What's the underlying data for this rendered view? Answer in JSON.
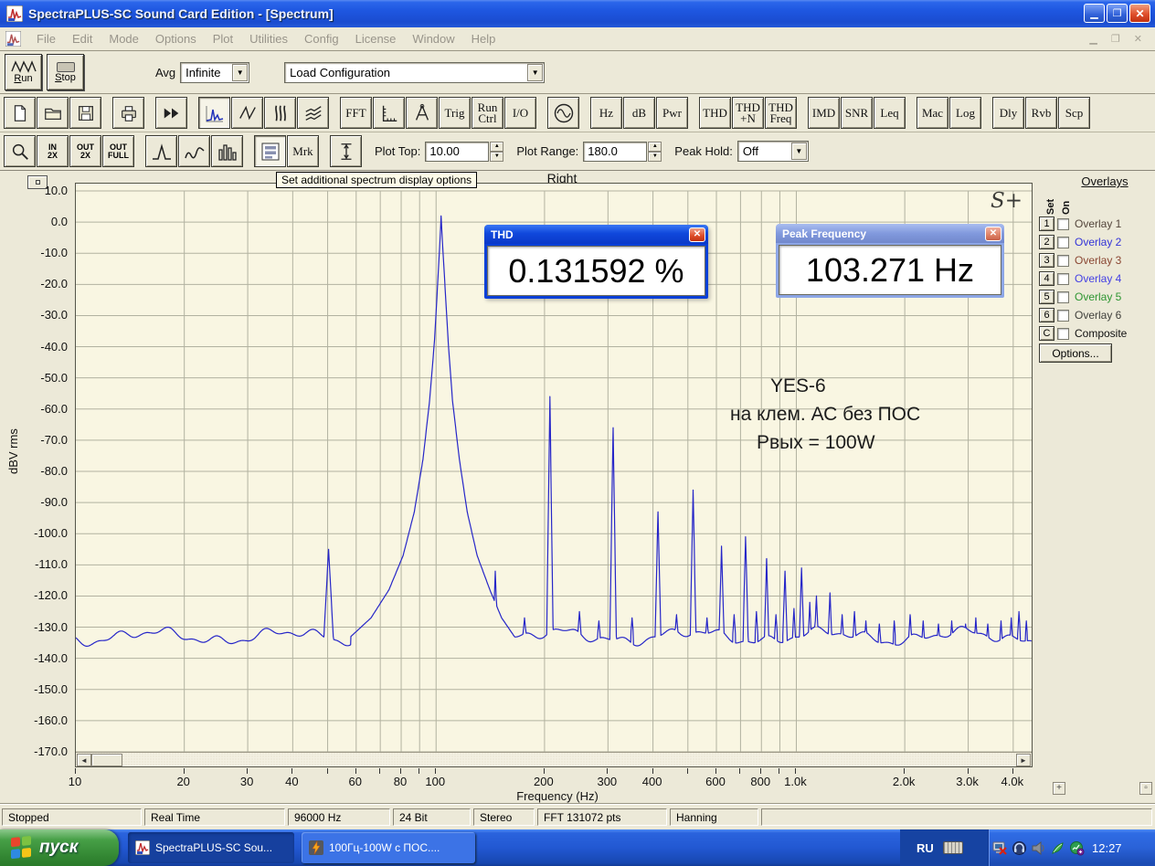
{
  "titlebar": {
    "title": "SpectraPLUS-SC Sound Card Edition - [Spectrum]"
  },
  "menubar": {
    "items": [
      "File",
      "Edit",
      "Mode",
      "Options",
      "Plot",
      "Utilities",
      "Config",
      "License",
      "Window",
      "Help"
    ]
  },
  "toolbar_main": {
    "run_label": "Run",
    "stop_label": "Stop",
    "avg_label": "Avg",
    "avg_value": "Infinite",
    "config_value": "Load Configuration"
  },
  "toolbar_views": {
    "fft": "FFT",
    "trig": "Trig",
    "run_ctrl": "Run\nCtrl",
    "io": "I/O",
    "hz": "Hz",
    "db": "dB",
    "pwr": "Pwr",
    "thd": "THD",
    "thd_n": "THD\n+N",
    "thd_freq": "THD\nFreq",
    "imd": "IMD",
    "snr": "SNR",
    "leq": "Leq",
    "mac": "Mac",
    "log": "Log",
    "dly": "Dly",
    "rvb": "Rvb",
    "scp": "Scp"
  },
  "toolbar_plot": {
    "in2x": "IN\n2X",
    "out2x": "OUT\n2X",
    "outfull": "OUT\nFULL",
    "mrk": "Mrk",
    "plot_top_label": "Plot Top:",
    "plot_top_value": "10.00",
    "plot_range_label": "Plot Range:",
    "plot_range_value": "180.0",
    "peak_hold_label": "Peak Hold:",
    "peak_hold_value": "Off"
  },
  "tooltip_text": "Set additional spectrum display options",
  "plot": {
    "channel_label": "Right",
    "logo": "S+"
  },
  "thd_window": {
    "title": "THD",
    "value": "0.131592 %"
  },
  "peak_window": {
    "title": "Peak Frequency",
    "value": "103.271 Hz"
  },
  "annotation": {
    "line1": "YES-6",
    "line2": "на клем. АС без ПОС",
    "line3": "Рвых = 100W"
  },
  "overlays": {
    "header": "Overlays",
    "col_set": "Set",
    "col_on": "On",
    "rows": [
      {
        "btn": "1",
        "label": "Overlay 1",
        "color": "#54463c"
      },
      {
        "btn": "2",
        "label": "Overlay 2",
        "color": "#3434d8"
      },
      {
        "btn": "3",
        "label": "Overlay 3",
        "color": "#8a4632"
      },
      {
        "btn": "4",
        "label": "Overlay 4",
        "color": "#4440e4"
      },
      {
        "btn": "5",
        "label": "Overlay 5",
        "color": "#2e9632"
      },
      {
        "btn": "6",
        "label": "Overlay 6",
        "color": "#40403c"
      },
      {
        "btn": "C",
        "label": "Composite",
        "color": "#101010"
      }
    ],
    "options_label": "Options..."
  },
  "statusbar": {
    "cells": [
      "Stopped",
      "Real Time",
      "96000 Hz",
      "24 Bit",
      "Stereo",
      "FFT 131072 pts",
      "Hanning"
    ]
  },
  "taskbar": {
    "start": "пуск",
    "task1": "SpectraPLUS-SC Sou...",
    "task2": "100Гц-100W с ПОС....",
    "lang": "RU",
    "clock": "12:27"
  },
  "chart_data": {
    "type": "line",
    "title": "Spectrum (Right channel)",
    "xlabel": "Frequency (Hz)",
    "ylabel": "dBV rms",
    "x_scale": "log",
    "xlim": [
      10,
      4500
    ],
    "ylim": [
      -170,
      10
    ],
    "y_tick_step_db": 10,
    "x_ticks": [
      {
        "f": 10,
        "label": "10"
      },
      {
        "f": 20,
        "label": "20"
      },
      {
        "f": 30,
        "label": "30"
      },
      {
        "f": 40,
        "label": "40"
      },
      {
        "f": 60,
        "label": "60"
      },
      {
        "f": 80,
        "label": "80"
      },
      {
        "f": 100,
        "label": "100"
      },
      {
        "f": 200,
        "label": "200"
      },
      {
        "f": 300,
        "label": "300"
      },
      {
        "f": 400,
        "label": "400"
      },
      {
        "f": 600,
        "label": "600"
      },
      {
        "f": 800,
        "label": "800"
      },
      {
        "f": 1000,
        "label": "1.0k"
      },
      {
        "f": 2000,
        "label": "2.0k"
      },
      {
        "f": 3000,
        "label": "3.0k"
      },
      {
        "f": 4000,
        "label": "4.0k"
      }
    ],
    "line_color": "#2626c8",
    "grid_color": "#b2b2a0",
    "bg_color": "#f9f6e2",
    "noise_floor_db": -133,
    "fundamental": {
      "freq_hz": 103.271,
      "db": 2,
      "thd_percent": 0.131592
    },
    "main_peak_skirt": [
      [
        58,
        -133
      ],
      [
        66,
        -127
      ],
      [
        74,
        -118
      ],
      [
        81,
        -107
      ],
      [
        87,
        -93
      ],
      [
        92,
        -76
      ],
      [
        96,
        -57
      ],
      [
        99,
        -38
      ],
      [
        101,
        -20
      ],
      [
        102.4,
        -7
      ],
      [
        103.271,
        2
      ],
      [
        104.2,
        -7
      ],
      [
        105.8,
        -20
      ],
      [
        108,
        -38
      ],
      [
        111,
        -57
      ],
      [
        116,
        -76
      ],
      [
        122,
        -93
      ],
      [
        130,
        -107
      ],
      [
        141,
        -118
      ],
      [
        152,
        -127
      ],
      [
        165,
        -133
      ]
    ],
    "harmonic_peaks": [
      [
        50.3,
        -105,
        0.013
      ],
      [
        146,
        -112,
        0.006
      ],
      [
        207,
        -56,
        0.009
      ],
      [
        310,
        -66,
        0.009
      ],
      [
        413,
        -93,
        0.008
      ],
      [
        517,
        -86,
        0.008
      ],
      [
        620,
        -104,
        0.007
      ],
      [
        723,
        -101,
        0.007
      ],
      [
        827,
        -108,
        0.006
      ],
      [
        930,
        -112,
        0.006
      ],
      [
        1034,
        -111,
        0.006
      ],
      [
        1137,
        -120,
        0.005
      ],
      [
        1240,
        -119,
        0.005
      ]
    ],
    "minor_peaks": [
      [
        176,
        -127,
        0.005
      ],
      [
        250,
        -125,
        0.005
      ],
      [
        283,
        -128,
        0.004
      ],
      [
        350,
        -127,
        0.004
      ],
      [
        465,
        -126,
        0.005
      ],
      [
        565,
        -127,
        0.004
      ],
      [
        672,
        -126,
        0.004
      ],
      [
        775,
        -125,
        0.004
      ],
      [
        878,
        -126,
        0.004
      ],
      [
        985,
        -124,
        0.004
      ],
      [
        1090,
        -122,
        0.004
      ],
      [
        1340,
        -126,
        0.004
      ],
      [
        1450,
        -125,
        0.004
      ],
      [
        1560,
        -128,
        0.003
      ],
      [
        1700,
        -129,
        0.003
      ],
      [
        1870,
        -128,
        0.003
      ],
      [
        2070,
        -126,
        0.004
      ],
      [
        2250,
        -128,
        0.003
      ],
      [
        2480,
        -129,
        0.003
      ],
      [
        2700,
        -128,
        0.003
      ],
      [
        2950,
        -129,
        0.003
      ],
      [
        3150,
        -127,
        0.003
      ],
      [
        3400,
        -129,
        0.003
      ],
      [
        3700,
        -128,
        0.003
      ],
      [
        3950,
        -127,
        0.003
      ],
      [
        4150,
        -125,
        0.004
      ],
      [
        4350,
        -128,
        0.003
      ]
    ]
  }
}
